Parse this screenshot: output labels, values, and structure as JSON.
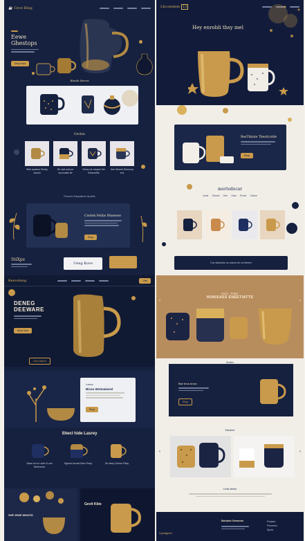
{
  "left": {
    "header": {
      "brand": "Ceve Hing"
    },
    "hero": {
      "title": "Eewe Ghestops",
      "cta": "Shop Now"
    },
    "s2": {
      "title": "Bhmfe Bweet"
    },
    "s3": {
      "title": "Gwitsn",
      "cards": [
        {
          "caption": "Sbbi anwens Shsrty Aamot"
        },
        {
          "caption": "Se eatt coloure sunvoiaits tie"
        },
        {
          "caption": "Shmrv at cubpee fhe fhearsetits"
        },
        {
          "caption": "Aee Wowrd Shmcrop ees"
        }
      ]
    },
    "s4": {
      "kicker": "Rnoxmis Mepptaines ticoalite",
      "title": "Cwiteh Felibs Wneeree",
      "cta": "Shop"
    },
    "s5": {
      "left_title": "StiXpe",
      "pill_title": "Ueng Kuve"
    },
    "s6": {
      "brand": "Keeveleng",
      "title_line1": "DENEG",
      "title_line2": "DEEWARE",
      "cta": "Shop Now",
      "cta2": "Clow Dauch",
      "cta3": "Visit"
    },
    "s7": {
      "kicker": "Lnerco",
      "title": "Biceu Wvtmaiwvel",
      "cta": "Shop"
    },
    "s8": {
      "title": "Shecl hide Lasrey",
      "captions": [
        "Swee hol vn ooth el ooe Dbelrorme",
        "Sgnest hrouts Eicer Rnicy",
        "Sh ebeq Cinfoor Rinly"
      ]
    },
    "s9": {
      "left_title": "SHE WWE MHATIS",
      "right_title": "Gevit Kbie"
    }
  },
  "right": {
    "header": {
      "brand": "Lhcomdem",
      "badge": "13"
    },
    "hero": {
      "title": "Hey enrobli thsy mel"
    },
    "s2": {
      "title": "ResThbate Thesitcolde",
      "cta": "Shop"
    },
    "s3": {
      "title": "mertedecar",
      "tabs": [
        "Aurie",
        "Cthosh",
        "Srer",
        "Gaor",
        "Prnoe",
        "Caboe"
      ]
    },
    "s4": {
      "caption": "Eoe bdicanbe ne uneoe ieh ea theenh"
    },
    "s5": {
      "title_line1": "GOL TIEE",
      "title_line2": "HUNISASS ENEETIATTS"
    },
    "s6": {
      "kicker": "Sueblo",
      "title": "Bwr brus brcse",
      "cta": "Shop"
    },
    "s7": {
      "kicker": "Esinerbe"
    },
    "s8": {
      "title": "Celis ifeem"
    },
    "footer": {
      "brand": "Cyvelgeen",
      "title": "Beubeb Geweine",
      "links": [
        "Fowpes",
        "Ffooneee",
        "Dpres"
      ]
    }
  },
  "colors": {
    "navy": "#16213f",
    "gold": "#c99a4b",
    "cream": "#f1eee8"
  }
}
